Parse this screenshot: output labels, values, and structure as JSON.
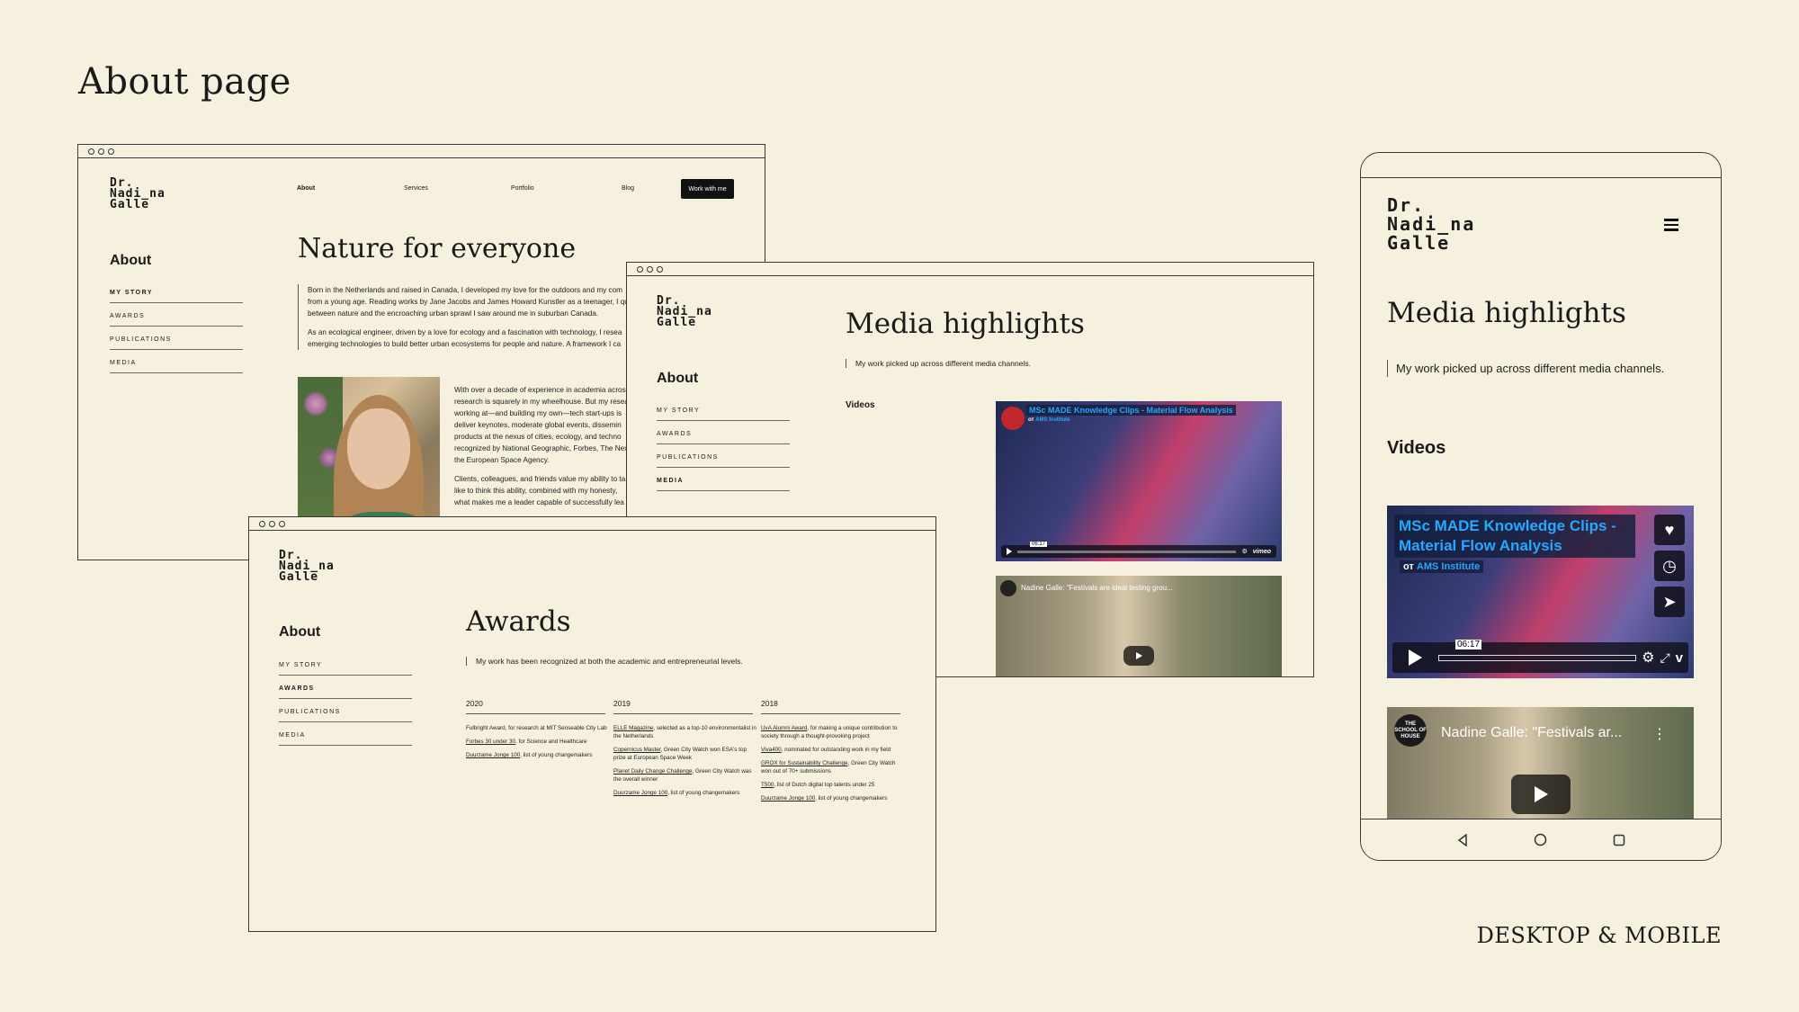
{
  "page": {
    "title": "About page",
    "footer_label": "DESKTOP & MOBILE"
  },
  "logo": {
    "line1": "Dr.",
    "line2": "Nadi_na",
    "line3": "Galle"
  },
  "nav": {
    "about": "About",
    "services": "Services",
    "portfolio": "Portfolio",
    "blog": "Blog",
    "cta": "Work with me"
  },
  "sidebar": {
    "title": "About",
    "items": [
      "MY STORY",
      "AWARDS",
      "PUBLICATIONS",
      "MEDIA"
    ]
  },
  "story": {
    "heading": "Nature for everyone",
    "para1_l1": "Born in the Netherlands and raised in Canada, I developed my love for the outdoors and my com",
    "para1_l2": "from a young age. Reading works by Jane Jacobs and James Howard Kunstler as a teenager, I que",
    "para1_l3": "between nature and the encroaching urban sprawl I saw around me in suburban Canada.",
    "para2_l1": "As an ecological engineer, driven by a love for ecology and a fascination with technology, I resea",
    "para2_l2": "emerging technologies to build better urban ecosystems for people and nature. A framework I ca",
    "col_l1": "With over a decade of experience in academia acros",
    "col_l2": "research is squarely in my wheelhouse. But my resea",
    "col_l3": "working at—and building my own—tech start-ups is",
    "col_l4": "deliver keynotes, moderate global events, dissemin",
    "col_l5": "products at the nexus of cities, ecology, and techno",
    "col_l6": "recognized by National Geographic, Forbes, The Nex",
    "col_l7": "the European Space Agency.",
    "col_l8": "Clients, colleagues, and friends value my ability to ta",
    "col_l9": "like to think this ability, combined with my honesty,",
    "col_l10": "what makes me a leader capable of successfully lea"
  },
  "media": {
    "heading": "Media highlights",
    "intro": "My work picked up across different media channels.",
    "videos_label": "Videos",
    "video1": {
      "title": "MSc MADE Knowledge Clips - Material Flow Analysis",
      "from": "от",
      "channel": "AMS Institute",
      "time": "06:17",
      "brand": "vimeo"
    },
    "video2": {
      "title_desktop": "Nadine Galle: \"Festivals are ideal testing grou...",
      "title_mobile": "Nadine Galle: \"Festivals ar...",
      "channel_logo": "THE SCHOOL OF HOUSE"
    }
  },
  "awards": {
    "heading": "Awards",
    "intro": "My work has been recognized at both the academic and entrepreneurial levels.",
    "y2020": "2020",
    "y2019": "2019",
    "y2018": "2018",
    "a2020_1_link": "",
    "a2020_1_text": "Fulbright Award, for research at MIT Senseable City Lab",
    "a2020_2_link": "Forbes 30 under 30",
    "a2020_2_text": ", for Science and Healthcare",
    "a2020_3_link": "Duurzame Jonge 100",
    "a2020_3_text": ", list of young changemakers",
    "a2019_1_link": "ELLE Magazine",
    "a2019_1_text": ", selected as a top-10 environmentalist in the Netherlands",
    "a2019_2_link": "Copernicus Master",
    "a2019_2_text": ", Green City Watch won ESA's top prize at European Space Week",
    "a2019_3_link": "Planet Daily Change Challenge",
    "a2019_3_text": ", Green City Watch was the overall winner",
    "a2019_4_link": "Duurzame Jonge 100",
    "a2019_4_text": ", list of young changemakers",
    "a2018_1_link": "UvA Alumni Award",
    "a2018_1_text": ", for making a unique contribution to society through a thought-provoking project",
    "a2018_2_link": "Viva400",
    "a2018_2_text": ", nominated for outstanding work in my field",
    "a2018_3_link": "GROX for Sustainability Challenge",
    "a2018_3_text": ", Green City Watch won out of 70+ submissions",
    "a2018_4_link": "T500",
    "a2018_4_text": ", list of Dutch digital top talents under 25",
    "a2018_5_link": "Duurzame Jonge 100",
    "a2018_5_text": ", list of young changemakers"
  },
  "colors": {
    "background": "#f6f0df",
    "ink": "#1a1a1a",
    "vimeo_blue": "#25a8ff"
  },
  "icons": [
    "hamburger-icon",
    "play-icon",
    "heart-icon",
    "clock-icon",
    "send-icon",
    "gear-icon",
    "fullscreen-icon",
    "back-icon",
    "home-icon",
    "recents-icon"
  ]
}
